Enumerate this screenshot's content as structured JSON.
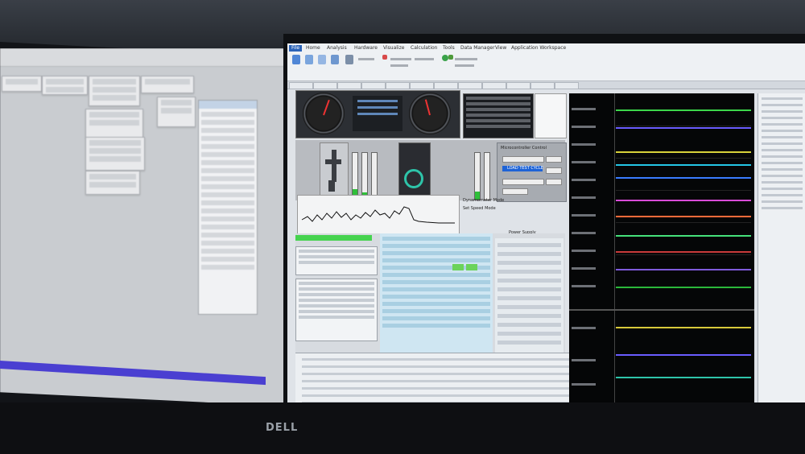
{
  "scene": "photo of computer monitors displaying engineering software",
  "brand_label": "DELL",
  "right_app": {
    "ribbon_tabs": [
      "File",
      "Home",
      "Analysis",
      "Hardware",
      "Visualize",
      "Calculation",
      "Tools",
      "Data Manager",
      "View",
      "Application Workspace"
    ],
    "microcontroller": {
      "title": "Microcontroller Control",
      "button": "LOAD TEST CYCLE",
      "labels": [
        "Start",
        "Pause",
        "Stop"
      ]
    },
    "mode_options": [
      "Dynamometer Mode",
      "Set Speed Mode"
    ],
    "power_supply_label": "Power Supply"
  },
  "colors": {
    "accent_blue": "#1e63d6",
    "status_green": "#46d34f",
    "ring_cyan": "#2ec4a9",
    "left_strip": "#4a3fd1"
  }
}
